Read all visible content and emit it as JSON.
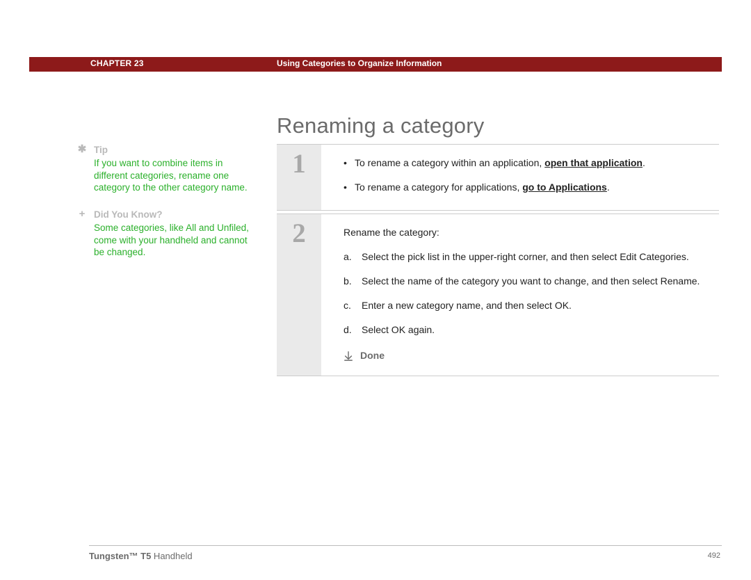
{
  "header": {
    "chapter_label": "CHAPTER 23",
    "chapter_title": "Using Categories to Organize Information"
  },
  "page_title": "Renaming a category",
  "sidebar": {
    "tip": {
      "heading": "Tip",
      "body": "If you want to combine items in different categories, rename one category to the other category name."
    },
    "dyk": {
      "heading": "Did You Know?",
      "body": "Some categories, like All and Unfiled, come with your handheld and cannot be changed."
    }
  },
  "steps": {
    "s1": {
      "num": "1",
      "bullet1_pre": "To rename a category within an application, ",
      "bullet1_link": "open that application",
      "bullet1_post": ".",
      "bullet2_pre": "To rename a category for applications, ",
      "bullet2_link": "go to Applications",
      "bullet2_post": "."
    },
    "s2": {
      "num": "2",
      "intro": "Rename the category:",
      "a": "Select the pick list in the upper-right corner, and then select Edit Categories.",
      "b": "Select the name of the category you want to change, and then select Rename.",
      "c": "Enter a new category name, and then select OK.",
      "d": "Select OK again.",
      "done": "Done"
    }
  },
  "footer": {
    "product_bold": "Tungsten™ T5",
    "product_rest": " Handheld",
    "page_number": "492"
  }
}
